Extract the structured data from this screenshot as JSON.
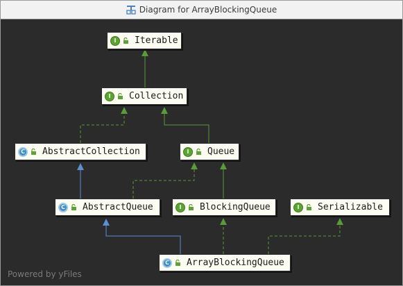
{
  "window": {
    "title": "Diagram for ArrayBlockingQueue",
    "title_icon": "class-diagram-icon"
  },
  "nodes": {
    "iterable": {
      "label": "Iterable",
      "kind": "interface",
      "badge": "I"
    },
    "collection": {
      "label": "Collection",
      "kind": "interface",
      "badge": "I"
    },
    "abstract_collection": {
      "label": "AbstractCollection",
      "kind": "abstract-class",
      "badge": "C"
    },
    "queue": {
      "label": "Queue",
      "kind": "interface",
      "badge": "I"
    },
    "abstract_queue": {
      "label": "AbstractQueue",
      "kind": "abstract-class",
      "badge": "C"
    },
    "blocking_queue": {
      "label": "BlockingQueue",
      "kind": "interface",
      "badge": "I"
    },
    "serializable": {
      "label": "Serializable",
      "kind": "interface",
      "badge": "I"
    },
    "array_blocking_queue": {
      "label": "ArrayBlockingQueue",
      "kind": "class",
      "badge": "C"
    }
  },
  "edges": [
    {
      "from": "Collection",
      "to": "Iterable",
      "type": "extends"
    },
    {
      "from": "AbstractCollection",
      "to": "Collection",
      "type": "implements"
    },
    {
      "from": "Queue",
      "to": "Collection",
      "type": "extends"
    },
    {
      "from": "AbstractQueue",
      "to": "AbstractCollection",
      "type": "extends-class"
    },
    {
      "from": "AbstractQueue",
      "to": "Queue",
      "type": "implements"
    },
    {
      "from": "BlockingQueue",
      "to": "Queue",
      "type": "extends"
    },
    {
      "from": "ArrayBlockingQueue",
      "to": "AbstractQueue",
      "type": "extends-class"
    },
    {
      "from": "ArrayBlockingQueue",
      "to": "BlockingQueue",
      "type": "implements"
    },
    {
      "from": "ArrayBlockingQueue",
      "to": "Serializable",
      "type": "implements"
    }
  ],
  "colors": {
    "background": "#2b2b2b",
    "node_fill": "#fdfcf2",
    "interface_edge": "#5a9a3a",
    "class_edge": "#5b8fd6",
    "interface_badge": "#5da234",
    "class_badge": "#3e8fc7"
  },
  "footer": "Powered by yFiles"
}
